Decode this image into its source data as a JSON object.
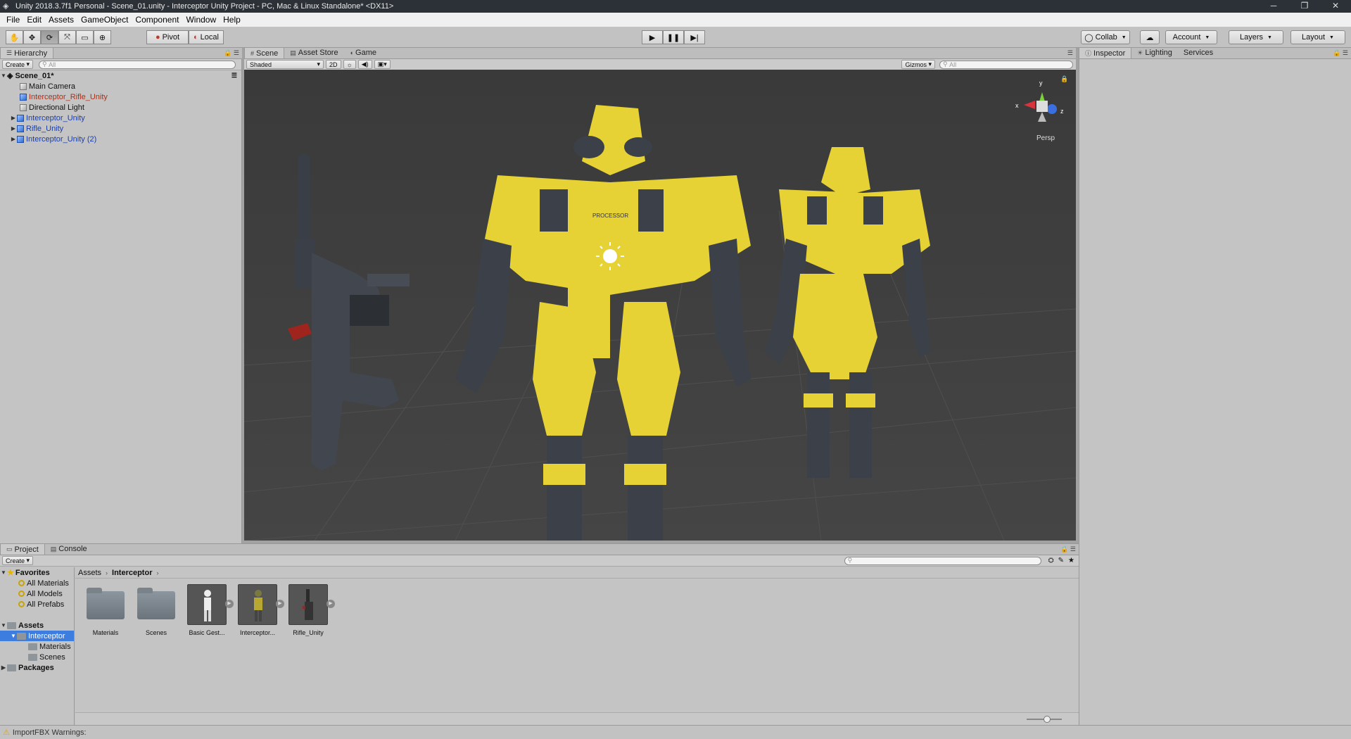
{
  "window": {
    "title": "Unity 2018.3.7f1 Personal - Scene_01.unity - Interceptor Unity Project - PC, Mac & Linux Standalone* <DX11>",
    "controls": [
      "─",
      "❐",
      "✕"
    ]
  },
  "menu": [
    "File",
    "Edit",
    "Assets",
    "GameObject",
    "Component",
    "Window",
    "Help"
  ],
  "toolbar": {
    "pivot": "Pivot",
    "local": "Local",
    "collab": "Collab",
    "account": "Account",
    "layers": "Layers",
    "layout": "Layout"
  },
  "hierarchy": {
    "tab": "Hierarchy",
    "create": "Create",
    "search_placeholder": "All",
    "scene": "Scene_01*",
    "items": [
      {
        "label": "Main Camera",
        "style": "normal",
        "expandable": false
      },
      {
        "label": "Interceptor_Rifle_Unity",
        "style": "red",
        "expandable": false
      },
      {
        "label": "Directional Light",
        "style": "normal",
        "expandable": false
      },
      {
        "label": "Interceptor_Unity",
        "style": "blue",
        "expandable": true
      },
      {
        "label": "Rifle_Unity",
        "style": "blue",
        "expandable": true
      },
      {
        "label": "Interceptor_Unity (2)",
        "style": "blue",
        "expandable": true
      }
    ]
  },
  "scene": {
    "tabs": [
      "Scene",
      "Asset Store",
      "Game"
    ],
    "active_tab": "Scene",
    "shading": "Shaded",
    "mode_2d": "2D",
    "gizmos": "Gizmos",
    "search_placeholder": "All",
    "persp_label": "Persp",
    "axis_x": "x",
    "axis_y": "y",
    "axis_z": "z",
    "robot_chest_text": "PROCESSOR"
  },
  "inspector": {
    "tabs": [
      "Inspector",
      "Lighting",
      "Services"
    ],
    "active_tab": "Inspector"
  },
  "project": {
    "tabs": [
      "Project",
      "Console"
    ],
    "active_tab": "Project",
    "create": "Create",
    "breadcrumb": [
      "Assets",
      "Interceptor"
    ],
    "tree": {
      "favorites_label": "Favorites",
      "favorites": [
        "All Materials",
        "All Models",
        "All Prefabs"
      ],
      "assets_label": "Assets",
      "selected": "Interceptor",
      "children": [
        "Materials",
        "Scenes"
      ],
      "packages_label": "Packages"
    },
    "assets": [
      {
        "label": "Materials",
        "kind": "folder"
      },
      {
        "label": "Scenes",
        "kind": "folder"
      },
      {
        "label": "Basic Gest...",
        "kind": "prefab"
      },
      {
        "label": "Interceptor...",
        "kind": "prefab"
      },
      {
        "label": "Rifle_Unity",
        "kind": "prefab"
      }
    ]
  },
  "status": {
    "message": "ImportFBX Warnings:"
  },
  "colors": {
    "robot_yellow": "#e6d234",
    "robot_dark": "#3c4048",
    "selection_blue": "#3e7de0",
    "scene_bg": "#4b4b4b"
  }
}
